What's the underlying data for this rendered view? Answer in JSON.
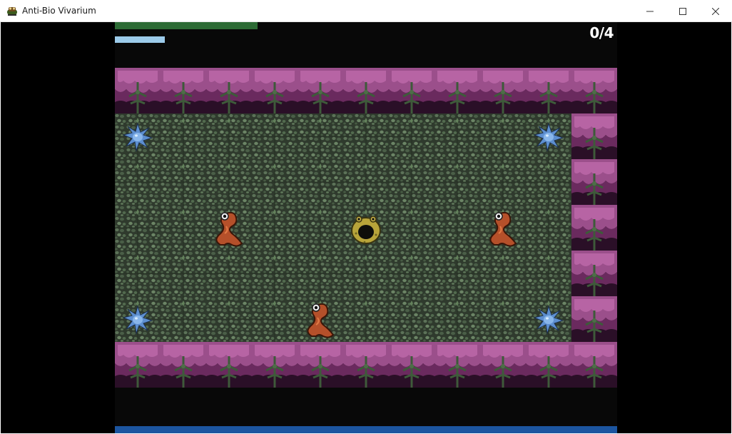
{
  "window": {
    "title": "Anti-Bio Vivarium",
    "icon": "frog-app-icon",
    "controls": [
      "minimize-icon",
      "maximize-icon",
      "close-icon"
    ]
  },
  "hud": {
    "score_text": "0/4",
    "health_fraction": 1.0,
    "energy_fraction": 0.35
  },
  "colors": {
    "floor": "#3a4a38",
    "wall_top": "#a0508f",
    "wall_dark": "#3b1536",
    "health": "#2d6b35",
    "energy": "#9ccbea",
    "bottom_bar": "#1c55a0",
    "worm": "#b5502a",
    "spore": "#5d8fd0",
    "player": "#b8a43a"
  },
  "map": {
    "cols": 11,
    "rows": 7,
    "tiles": [
      "WWWWWWWWWWW",
      "FFFFFFFFFFW",
      "FFFFFFFFFFW",
      "FFFFFFFFFFW",
      "FFFFFFFFFFW",
      "FFFFFFFFFFW",
      "WWWWWWWWWWW"
    ]
  },
  "entities": [
    {
      "type": "spore",
      "col": 0,
      "row": 1
    },
    {
      "type": "spore",
      "col": 9,
      "row": 1
    },
    {
      "type": "worm",
      "col": 2,
      "row": 3
    },
    {
      "type": "player",
      "col": 5,
      "row": 3
    },
    {
      "type": "worm",
      "col": 8,
      "row": 3
    },
    {
      "type": "spore",
      "col": 0,
      "row": 5
    },
    {
      "type": "worm",
      "col": 4,
      "row": 5
    },
    {
      "type": "spore",
      "col": 9,
      "row": 5
    }
  ]
}
